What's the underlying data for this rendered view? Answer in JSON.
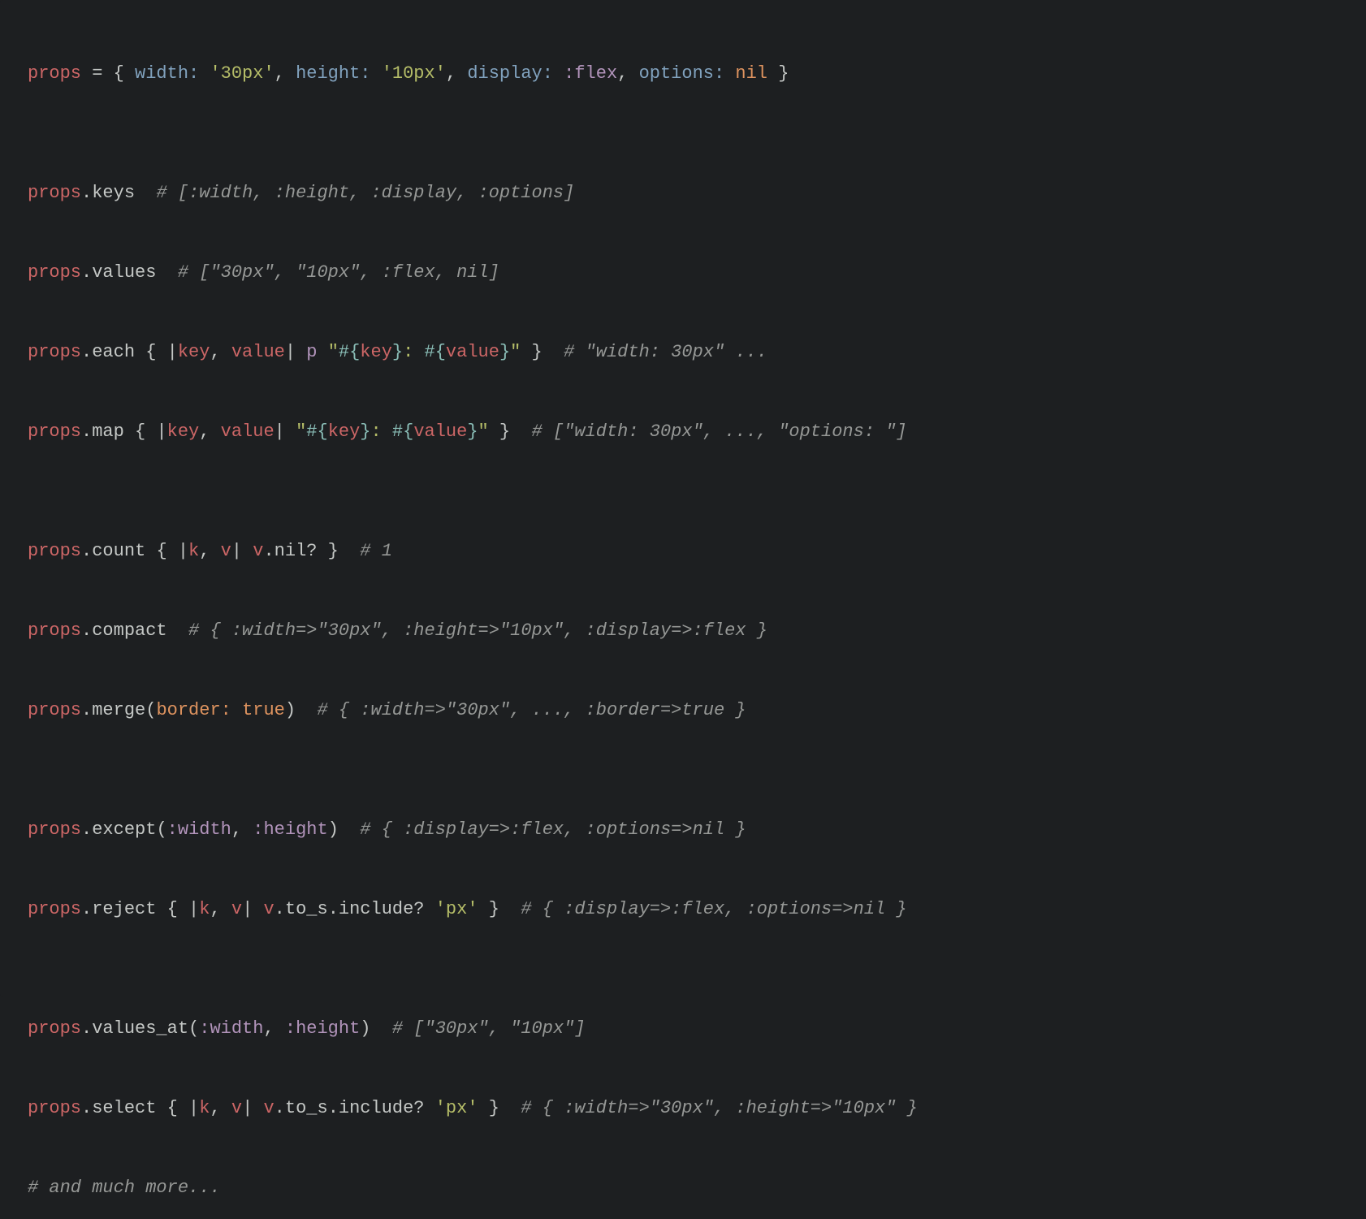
{
  "lines": {
    "l1": {
      "var": "props",
      "eq": " = ",
      "lbrace": "{ ",
      "k_width": "width:",
      "sp1": " ",
      "v_width": "'30px'",
      "c1": ", ",
      "k_height": "height:",
      "sp2": " ",
      "v_height": "'10px'",
      "c2": ", ",
      "k_display": "display:",
      "sp3": " ",
      "v_display": ":flex",
      "c3": ", ",
      "k_options": "options:",
      "sp4": " ",
      "v_options": "nil",
      "rbrace": " }"
    },
    "l2": {
      "var": "props",
      "dot": ".",
      "method": "keys",
      "pad": "  ",
      "comment": "# [:width, :height, :display, :options]"
    },
    "l3": {
      "var": "props",
      "dot": ".",
      "method": "values",
      "pad": "  ",
      "comment": "# [\"30px\", \"10px\", :flex, nil]"
    },
    "l4": {
      "var": "props",
      "dot": ".",
      "method": "each",
      "sp": " ",
      "lbrace": "{ ",
      "pipe1": "|",
      "p_key": "key",
      "comma": ", ",
      "p_value": "value",
      "pipe2": "|",
      "sp2": " ",
      "pfn": "p",
      "sp3": " ",
      "q1": "\"",
      "iopen1": "#{",
      "ivar1": "key",
      "iclose1": "}",
      "mid": ": ",
      "iopen2": "#{",
      "ivar2": "value",
      "iclose2": "}",
      "q2": "\"",
      "rbrace": " }",
      "pad": "  ",
      "comment": "# \"width: 30px\" ..."
    },
    "l5": {
      "var": "props",
      "dot": ".",
      "method": "map",
      "sp": " ",
      "lbrace": "{ ",
      "pipe1": "|",
      "p_key": "key",
      "comma": ", ",
      "p_value": "value",
      "pipe2": "|",
      "sp2": " ",
      "q1": "\"",
      "iopen1": "#{",
      "ivar1": "key",
      "iclose1": "}",
      "mid": ": ",
      "iopen2": "#{",
      "ivar2": "value",
      "iclose2": "}",
      "q2": "\"",
      "rbrace": " }",
      "pad": "  ",
      "comment": "# [\"width: 30px\", ..., \"options: \"]"
    },
    "l6": {
      "var": "props",
      "dot": ".",
      "method": "count",
      "sp": " ",
      "lbrace": "{ ",
      "pipe1": "|",
      "p_k": "k",
      "comma": ", ",
      "p_v": "v",
      "pipe2": "|",
      "sp2": " ",
      "vvar": "v",
      "dot2": ".",
      "nilq": "nil?",
      "rbrace": " }",
      "pad": "  ",
      "comment": "# 1"
    },
    "l7": {
      "var": "props",
      "dot": ".",
      "method": "compact",
      "pad": "  ",
      "comment": "# { :width=>\"30px\", :height=>\"10px\", :display=>:flex }"
    },
    "l8": {
      "var": "props",
      "dot": ".",
      "method": "merge",
      "lparen": "(",
      "kw": "border:",
      "sp": " ",
      "true": "true",
      "rparen": ")",
      "pad": "  ",
      "comment": "# { :width=>\"30px\", ..., :border=>true }"
    },
    "l9": {
      "var": "props",
      "dot": ".",
      "method": "except",
      "lparen": "(",
      "a1": ":width",
      "comma": ", ",
      "a2": ":height",
      "rparen": ")",
      "pad": "  ",
      "comment": "# { :display=>:flex, :options=>nil }"
    },
    "l10": {
      "var": "props",
      "dot": ".",
      "method": "reject",
      "sp": " ",
      "lbrace": "{ ",
      "pipe1": "|",
      "p_k": "k",
      "comma": ", ",
      "p_v": "v",
      "pipe2": "|",
      "sp2": " ",
      "vvar": "v",
      "dot2": ".",
      "to_s": "to_s",
      "dot3": ".",
      "incl": "include?",
      "sp3": " ",
      "px": "'px'",
      "rbrace": " }",
      "pad": "  ",
      "comment": "# { :display=>:flex, :options=>nil }"
    },
    "l11": {
      "var": "props",
      "dot": ".",
      "method": "values_at",
      "lparen": "(",
      "a1": ":width",
      "comma": ", ",
      "a2": ":height",
      "rparen": ")",
      "pad": "  ",
      "comment": "# [\"30px\", \"10px\"]"
    },
    "l12": {
      "var": "props",
      "dot": ".",
      "method": "select",
      "sp": " ",
      "lbrace": "{ ",
      "pipe1": "|",
      "p_k": "k",
      "comma": ", ",
      "p_v": "v",
      "pipe2": "|",
      "sp2": " ",
      "vvar": "v",
      "dot2": ".",
      "to_s": "to_s",
      "dot3": ".",
      "incl": "include?",
      "sp3": " ",
      "px": "'px'",
      "rbrace": " }",
      "pad": "  ",
      "comment": "# { :width=>\"30px\", :height=>\"10px\" }"
    },
    "l13": {
      "comment": "# and much more..."
    }
  }
}
